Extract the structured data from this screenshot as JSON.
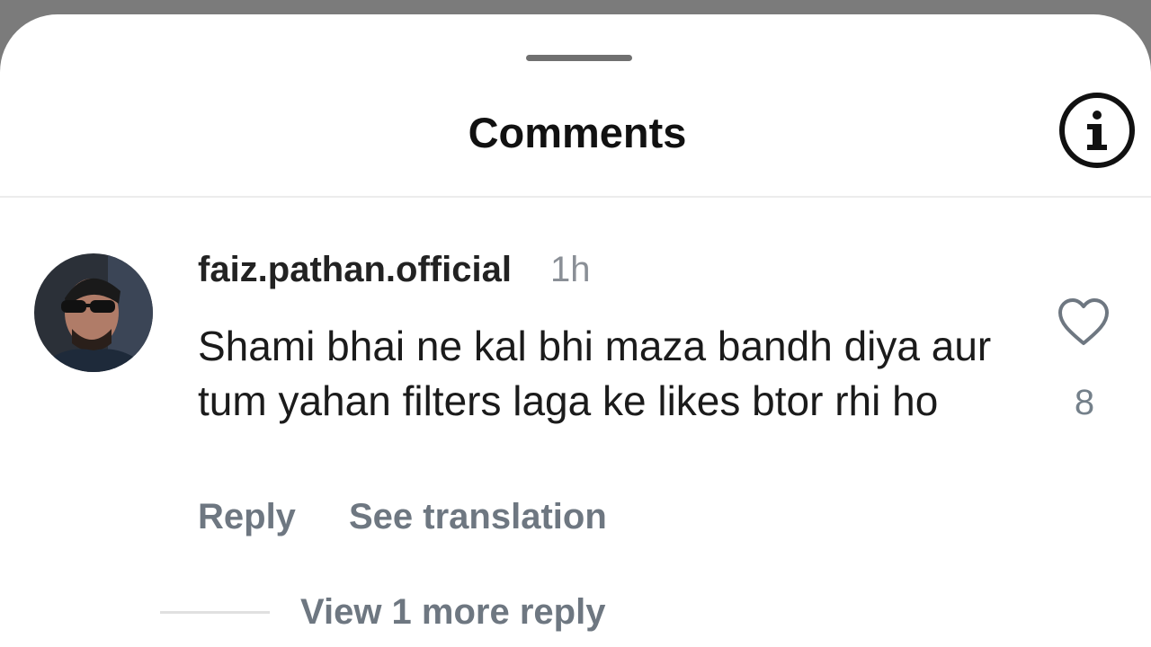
{
  "header": {
    "title": "Comments",
    "info_icon": "info-icon"
  },
  "comment": {
    "username": "faiz.pathan.official",
    "time": "1h",
    "text": "Shami bhai ne kal bhi maza bandh diya aur tum yahan filters laga ke likes btor rhi ho",
    "like_icon": "heart-icon",
    "like_count": "8",
    "reply_label": "Reply",
    "translate_label": "See translation",
    "more_replies_label": "View 1 more reply"
  },
  "colors": {
    "text_primary": "#111111",
    "text_secondary": "#6e7781",
    "backdrop": "#7b7b7b",
    "sheet": "#ffffff"
  }
}
